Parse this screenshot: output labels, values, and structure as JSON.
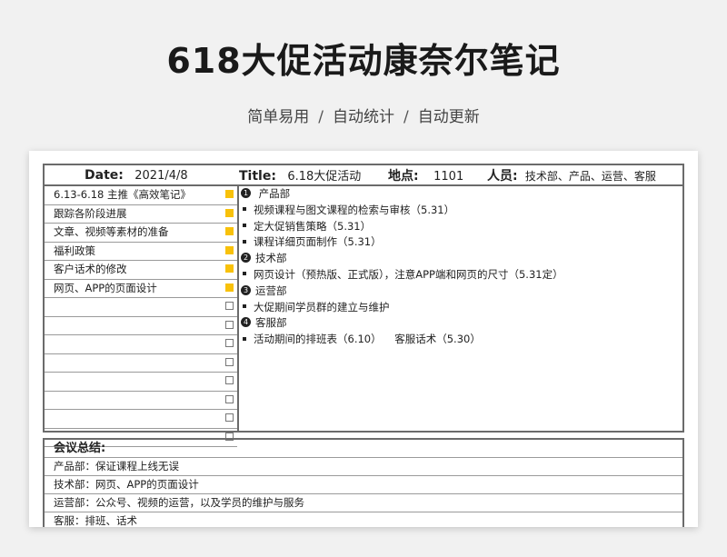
{
  "page": {
    "title": "618大促活动康奈尔笔记",
    "subtitle": [
      "简单易用",
      "自动统计",
      "自动更新"
    ],
    "separator": "/"
  },
  "header": {
    "date_label": "Date:",
    "date_value": "2021/4/8",
    "title_label": "Title:",
    "title_value": "6.18大促活动",
    "location_label": "地点:",
    "location_value": "1101",
    "people_label": "人员:",
    "people_value": "技术部、产品、运营、客服"
  },
  "left_items": [
    {
      "label": "6.13-6.18 主推《高效笔记》",
      "checked": true
    },
    {
      "label": "跟踪各阶段进展",
      "checked": true
    },
    {
      "label": "文章、视频等素材的准备",
      "checked": true
    },
    {
      "label": "福利政策",
      "checked": true
    },
    {
      "label": "客户话术的修改",
      "checked": true
    },
    {
      "label": "网页、APP的页面设计",
      "checked": true
    },
    {
      "label": "",
      "checked": false
    },
    {
      "label": "",
      "checked": false
    },
    {
      "label": "",
      "checked": false
    },
    {
      "label": "",
      "checked": false
    },
    {
      "label": "",
      "checked": false
    },
    {
      "label": "",
      "checked": false
    },
    {
      "label": "",
      "checked": false
    },
    {
      "label": "",
      "checked": false
    }
  ],
  "notes": [
    {
      "num": "1",
      "title": " 产品部",
      "items": [
        "视频课程与图文课程的检索与审核（5.31）",
        "定大促销售策略（5.31）",
        "课程详细页面制作（5.31）"
      ]
    },
    {
      "num": "2",
      "title": "技术部",
      "items": [
        "网页设计（预热版、正式版），注意APP端和网页的尺寸（5.31定）"
      ]
    },
    {
      "num": "3",
      "title": "运营部",
      "items": [
        "大促期间学员群的建立与维护"
      ]
    },
    {
      "num": "4",
      "title": "客服部",
      "items": [
        "活动期间的排班表（6.10）    客服话术（5.30）"
      ]
    }
  ],
  "summary": {
    "heading": "会议总结:",
    "rows": [
      "产品部：保证课程上线无误",
      "技术部：网页、APP的页面设计",
      "运营部：公众号、视频的运营，以及学员的维护与服务",
      "客服：排班、话术"
    ]
  },
  "colors": {
    "checkbox_on": "#f8c10a",
    "border": "#6b6b6b"
  }
}
